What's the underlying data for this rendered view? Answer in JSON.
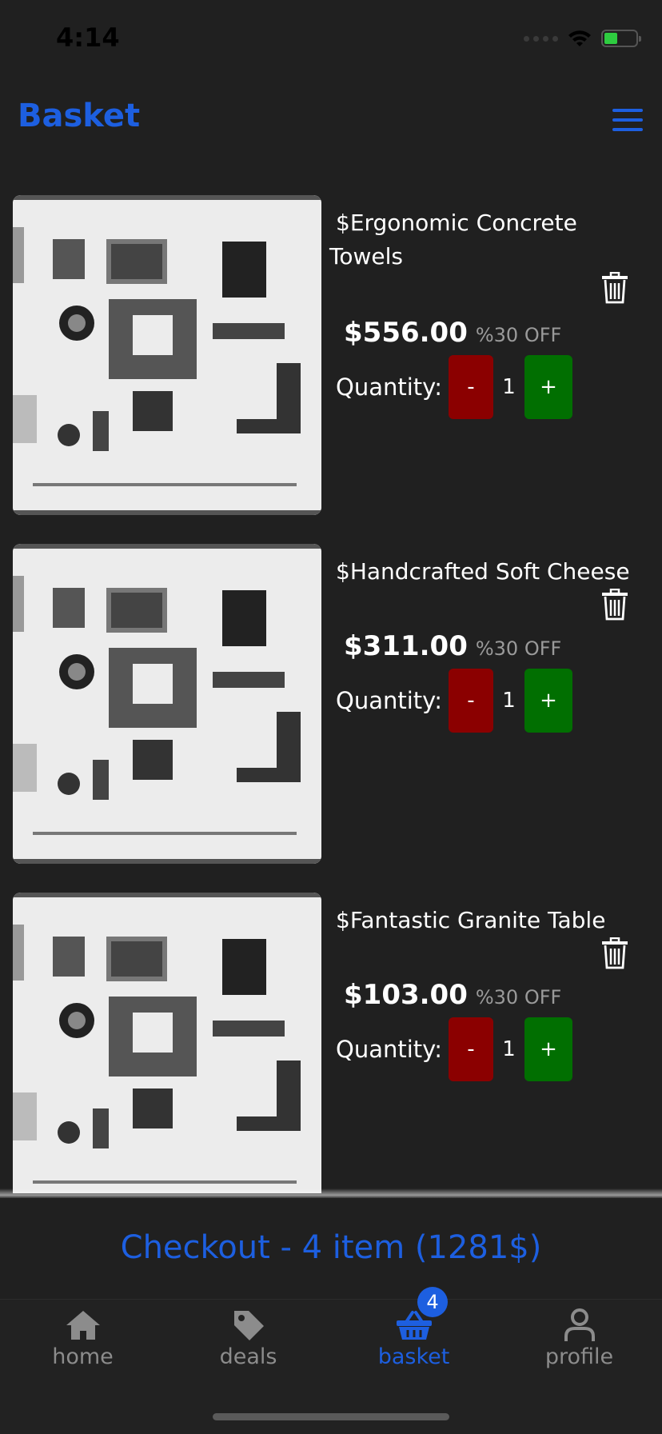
{
  "status_bar": {
    "time": "4:14"
  },
  "header": {
    "title": "Basket"
  },
  "items": [
    {
      "name": "$Ergonomic Concrete Towels",
      "price": "$556.00",
      "discount": "%30 OFF",
      "quantity_label": "Quantity:",
      "minus_label": "-",
      "quantity": "1",
      "plus_label": "+"
    },
    {
      "name": "$Handcrafted Soft Cheese",
      "price": "$311.00",
      "discount": "%30 OFF",
      "quantity_label": "Quantity:",
      "minus_label": "-",
      "quantity": "1",
      "plus_label": "+"
    },
    {
      "name": "$Fantastic Granite Table",
      "price": "$103.00",
      "discount": "%30 OFF",
      "quantity_label": "Quantity:",
      "minus_label": "-",
      "quantity": "1",
      "plus_label": "+"
    }
  ],
  "checkout": {
    "label": "Checkout - 4 item (1281$)"
  },
  "tab_bar": {
    "tabs": [
      {
        "label": "home",
        "icon": "home-icon"
      },
      {
        "label": "deals",
        "icon": "tag-icon"
      },
      {
        "label": "basket",
        "icon": "basket-icon",
        "badge": "4"
      },
      {
        "label": "profile",
        "icon": "user-icon"
      }
    ]
  },
  "colors": {
    "accent": "#1d5fe0",
    "minus": "#8b0000",
    "plus": "#016f01",
    "background": "#202020"
  }
}
